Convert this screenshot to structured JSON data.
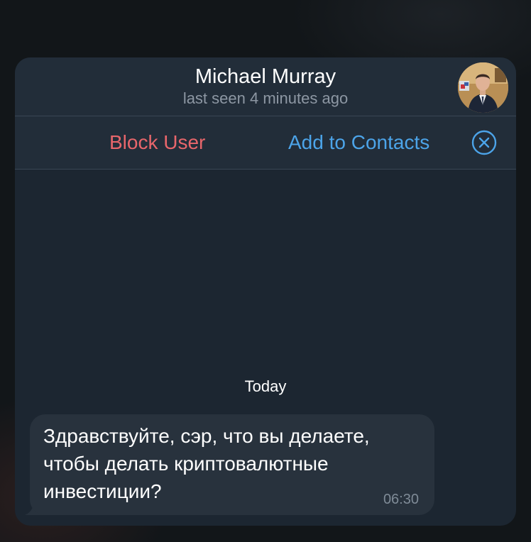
{
  "header": {
    "name": "Michael Murray",
    "status": "last seen 4 minutes ago"
  },
  "actions": {
    "block_label": "Block User",
    "add_label": "Add to Contacts",
    "close_icon": "close-circle-icon"
  },
  "chat": {
    "date_label": "Today",
    "messages": [
      {
        "text": "Здравствуйте, сэр, что вы делаете,\nчтобы делать криптовалютные\nинвестиции?",
        "time": "06:30"
      }
    ]
  },
  "colors": {
    "card_bg": "#1c2631",
    "header_bg": "#222d39",
    "block_red": "#e8666b",
    "link_blue": "#4ca4e9",
    "bubble_bg": "#28323d"
  }
}
